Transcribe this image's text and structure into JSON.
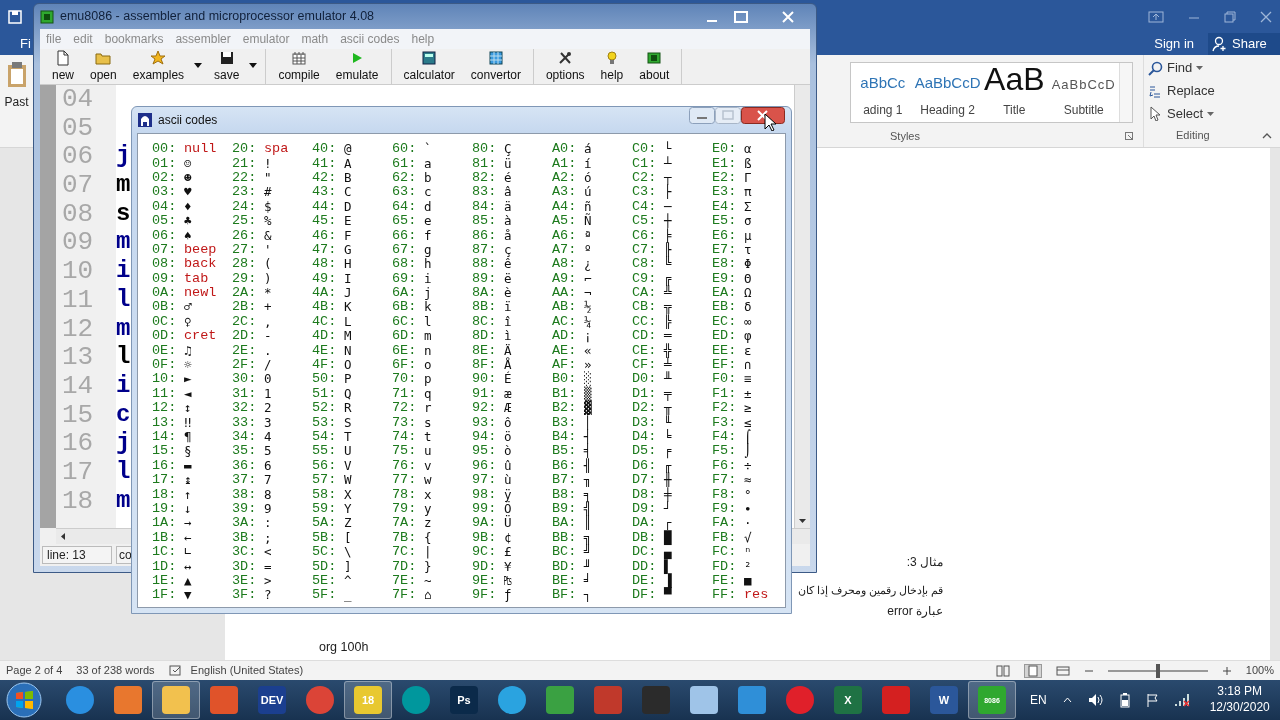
{
  "word": {
    "file_tab": "Fi",
    "paste_label": "Past",
    "sign_in": "Sign in",
    "share": "Share",
    "styles": [
      {
        "sample": "aBbCc",
        "label": "ading 1",
        "kind": "heading"
      },
      {
        "sample": "AaBbCcD",
        "label": "Heading 2",
        "kind": "heading"
      },
      {
        "sample": "AaB",
        "label": "Title",
        "kind": "title"
      },
      {
        "sample": "AaBbCcD",
        "label": "Subtitle",
        "kind": "subtitle"
      }
    ],
    "styles_group": "Styles",
    "editing": [
      {
        "label": "Find",
        "kind": "find",
        "dropdown": true
      },
      {
        "label": "Replace",
        "kind": "replace",
        "dropdown": false
      },
      {
        "label": "Select",
        "kind": "select",
        "dropdown": true
      }
    ],
    "editing_group": "Editing",
    "document": {
      "rtl_lines": [
        "مثال 3:",
        "قم بإدخال رقمين ومحرف إذا كان",
        "عبارة error"
      ],
      "code_line": "org 100h"
    },
    "status_bar": {
      "page": "Page 2 of 4",
      "words": "33 of 238 words",
      "language": "English (United States)",
      "zoom_slider": {
        "level": 0.5
      },
      "zoom": "100%"
    }
  },
  "emu": {
    "title": "emu8086 - assembler and microprocessor emulator 4.08",
    "menu": [
      "file",
      "edit",
      "bookmarks",
      "assembler",
      "emulator",
      "math",
      "ascii codes",
      "help"
    ],
    "toolbar": [
      {
        "items": [
          {
            "label": "new",
            "kind": "page",
            "dropdown": false
          },
          {
            "label": "open",
            "kind": "folder",
            "dropdown": false
          },
          {
            "label": "examples",
            "kind": "star",
            "dropdown": true
          },
          {
            "label": "save",
            "kind": "disk",
            "dropdown": true
          }
        ]
      },
      {
        "items": [
          {
            "label": "compile",
            "kind": "grid",
            "dropdown": false
          },
          {
            "label": "emulate",
            "kind": "play",
            "dropdown": false
          }
        ]
      },
      {
        "items": [
          {
            "label": "calculator",
            "kind": "calculator",
            "dropdown": false
          },
          {
            "label": "convertor",
            "kind": "convertor",
            "dropdown": false
          }
        ]
      },
      {
        "items": [
          {
            "label": "options",
            "kind": "tools",
            "dropdown": false
          },
          {
            "label": "help",
            "kind": "bulb",
            "dropdown": false
          },
          {
            "label": "about",
            "kind": "chip",
            "dropdown": false
          }
        ]
      }
    ],
    "editor": {
      "lines": [
        {
          "number": "04"
        },
        {
          "number": "05"
        },
        {
          "number": "06",
          "code": "j",
          "color": "#00008b"
        },
        {
          "number": "07",
          "code": "m",
          "color": "#000000"
        },
        {
          "number": "08",
          "code": "s",
          "color": "#000000"
        },
        {
          "number": "09",
          "code": "m",
          "color": "#00008b"
        },
        {
          "number": "10",
          "code": "i",
          "color": "#00008b"
        },
        {
          "number": "11",
          "code": "l",
          "color": "#00008b"
        },
        {
          "number": "12",
          "code": "m",
          "color": "#00008b"
        },
        {
          "number": "13",
          "code": "l",
          "color": "#000000"
        },
        {
          "number": "14",
          "code": "i",
          "color": "#00008b"
        },
        {
          "number": "15",
          "code": "c",
          "color": "#00008b"
        },
        {
          "number": "16",
          "code": "j",
          "color": "#00008b"
        },
        {
          "number": "17",
          "code": "l",
          "color": "#00008b"
        },
        {
          "number": "18",
          "code": "m",
          "color": "#00008b"
        }
      ]
    },
    "status": [
      "line: 13",
      "co"
    ]
  },
  "ascii": {
    "title": "ascii codes",
    "columns": [
      {
        "cells": [
          {
            "code": "00:",
            "symbol": "null",
            "kind": "name"
          },
          {
            "code": "01:",
            "symbol": "☺",
            "kind": "char"
          },
          {
            "code": "02:",
            "symbol": "☻",
            "kind": "char"
          },
          {
            "code": "03:",
            "symbol": "♥",
            "kind": "char"
          },
          {
            "code": "04:",
            "symbol": "♦",
            "kind": "char"
          },
          {
            "code": "05:",
            "symbol": "♣",
            "kind": "char"
          },
          {
            "code": "06:",
            "symbol": "♠",
            "kind": "char"
          },
          {
            "code": "07:",
            "symbol": "beep",
            "kind": "name"
          },
          {
            "code": "08:",
            "symbol": "back",
            "kind": "name"
          },
          {
            "code": "09:",
            "symbol": "tab",
            "kind": "name"
          },
          {
            "code": "0A:",
            "symbol": "newl",
            "kind": "name"
          },
          {
            "code": "0B:",
            "symbol": "♂",
            "kind": "char"
          },
          {
            "code": "0C:",
            "symbol": "♀",
            "kind": "char"
          },
          {
            "code": "0D:",
            "symbol": "cret",
            "kind": "name"
          },
          {
            "code": "0E:",
            "symbol": "♫",
            "kind": "char"
          },
          {
            "code": "0F:",
            "symbol": "☼",
            "kind": "char"
          },
          {
            "code": "10:",
            "symbol": "►",
            "kind": "char"
          },
          {
            "code": "11:",
            "symbol": "◄",
            "kind": "char"
          },
          {
            "code": "12:",
            "symbol": "↕",
            "kind": "char"
          },
          {
            "code": "13:",
            "symbol": "‼",
            "kind": "char"
          },
          {
            "code": "14:",
            "symbol": "¶",
            "kind": "char"
          },
          {
            "code": "15:",
            "symbol": "§",
            "kind": "char"
          },
          {
            "code": "16:",
            "symbol": "▬",
            "kind": "char"
          },
          {
            "code": "17:",
            "symbol": "↨",
            "kind": "char"
          },
          {
            "code": "18:",
            "symbol": "↑",
            "kind": "char"
          },
          {
            "code": "19:",
            "symbol": "↓",
            "kind": "char"
          },
          {
            "code": "1A:",
            "symbol": "→",
            "kind": "char"
          },
          {
            "code": "1B:",
            "symbol": "←",
            "kind": "char"
          },
          {
            "code": "1C:",
            "symbol": "∟",
            "kind": "char"
          },
          {
            "code": "1D:",
            "symbol": "↔",
            "kind": "char"
          },
          {
            "code": "1E:",
            "symbol": "▲",
            "kind": "char"
          },
          {
            "code": "1F:",
            "symbol": "▼",
            "kind": "char"
          }
        ]
      },
      {
        "cells": [
          {
            "code": "20:",
            "symbol": "spa",
            "kind": "name"
          },
          {
            "code": "21:",
            "symbol": "!",
            "kind": "char"
          },
          {
            "code": "22:",
            "symbol": "\"",
            "kind": "char"
          },
          {
            "code": "23:",
            "symbol": "#",
            "kind": "char"
          },
          {
            "code": "24:",
            "symbol": "$",
            "kind": "char"
          },
          {
            "code": "25:",
            "symbol": "%",
            "kind": "char"
          },
          {
            "code": "26:",
            "symbol": "&",
            "kind": "char"
          },
          {
            "code": "27:",
            "symbol": "'",
            "kind": "char"
          },
          {
            "code": "28:",
            "symbol": "(",
            "kind": "char"
          },
          {
            "code": "29:",
            "symbol": ")",
            "kind": "char"
          },
          {
            "code": "2A:",
            "symbol": "*",
            "kind": "char"
          },
          {
            "code": "2B:",
            "symbol": "+",
            "kind": "char"
          },
          {
            "code": "2C:",
            "symbol": ",",
            "kind": "char"
          },
          {
            "code": "2D:",
            "symbol": "-",
            "kind": "char"
          },
          {
            "code": "2E:",
            "symbol": ".",
            "kind": "char"
          },
          {
            "code": "2F:",
            "symbol": "/",
            "kind": "char"
          },
          {
            "code": "30:",
            "symbol": "0",
            "kind": "char"
          },
          {
            "code": "31:",
            "symbol": "1",
            "kind": "char"
          },
          {
            "code": "32:",
            "symbol": "2",
            "kind": "char"
          },
          {
            "code": "33:",
            "symbol": "3",
            "kind": "char"
          },
          {
            "code": "34:",
            "symbol": "4",
            "kind": "char"
          },
          {
            "code": "35:",
            "symbol": "5",
            "kind": "char"
          },
          {
            "code": "36:",
            "symbol": "6",
            "kind": "char"
          },
          {
            "code": "37:",
            "symbol": "7",
            "kind": "char"
          },
          {
            "code": "38:",
            "symbol": "8",
            "kind": "char"
          },
          {
            "code": "39:",
            "symbol": "9",
            "kind": "char"
          },
          {
            "code": "3A:",
            "symbol": ":",
            "kind": "char"
          },
          {
            "code": "3B:",
            "symbol": ";",
            "kind": "char"
          },
          {
            "code": "3C:",
            "symbol": "<",
            "kind": "char"
          },
          {
            "code": "3D:",
            "symbol": "=",
            "kind": "char"
          },
          {
            "code": "3E:",
            "symbol": ">",
            "kind": "char"
          },
          {
            "code": "3F:",
            "symbol": "?",
            "kind": "char"
          }
        ]
      },
      {
        "cells": [
          {
            "code": "40:",
            "symbol": "@",
            "kind": "char"
          },
          {
            "code": "41:",
            "symbol": "A",
            "kind": "char"
          },
          {
            "code": "42:",
            "symbol": "B",
            "kind": "char"
          },
          {
            "code": "43:",
            "symbol": "C",
            "kind": "char"
          },
          {
            "code": "44:",
            "symbol": "D",
            "kind": "char"
          },
          {
            "code": "45:",
            "symbol": "E",
            "kind": "char"
          },
          {
            "code": "46:",
            "symbol": "F",
            "kind": "char"
          },
          {
            "code": "47:",
            "symbol": "G",
            "kind": "char"
          },
          {
            "code": "48:",
            "symbol": "H",
            "kind": "char"
          },
          {
            "code": "49:",
            "symbol": "I",
            "kind": "char"
          },
          {
            "code": "4A:",
            "symbol": "J",
            "kind": "char"
          },
          {
            "code": "4B:",
            "symbol": "K",
            "kind": "char"
          },
          {
            "code": "4C:",
            "symbol": "L",
            "kind": "char"
          },
          {
            "code": "4D:",
            "symbol": "M",
            "kind": "char"
          },
          {
            "code": "4E:",
            "symbol": "N",
            "kind": "char"
          },
          {
            "code": "4F:",
            "symbol": "O",
            "kind": "char"
          },
          {
            "code": "50:",
            "symbol": "P",
            "kind": "char"
          },
          {
            "code": "51:",
            "symbol": "Q",
            "kind": "char"
          },
          {
            "code": "52:",
            "symbol": "R",
            "kind": "char"
          },
          {
            "code": "53:",
            "symbol": "S",
            "kind": "char"
          },
          {
            "code": "54:",
            "symbol": "T",
            "kind": "char"
          },
          {
            "code": "55:",
            "symbol": "U",
            "kind": "char"
          },
          {
            "code": "56:",
            "symbol": "V",
            "kind": "char"
          },
          {
            "code": "57:",
            "symbol": "W",
            "kind": "char"
          },
          {
            "code": "58:",
            "symbol": "X",
            "kind": "char"
          },
          {
            "code": "59:",
            "symbol": "Y",
            "kind": "char"
          },
          {
            "code": "5A:",
            "symbol": "Z",
            "kind": "char"
          },
          {
            "code": "5B:",
            "symbol": "[",
            "kind": "char"
          },
          {
            "code": "5C:",
            "symbol": "\\",
            "kind": "char"
          },
          {
            "code": "5D:",
            "symbol": "]",
            "kind": "char"
          },
          {
            "code": "5E:",
            "symbol": "^",
            "kind": "char"
          },
          {
            "code": "5F:",
            "symbol": "_",
            "kind": "char"
          }
        ]
      },
      {
        "cells": [
          {
            "code": "60:",
            "symbol": "`",
            "kind": "char"
          },
          {
            "code": "61:",
            "symbol": "a",
            "kind": "char"
          },
          {
            "code": "62:",
            "symbol": "b",
            "kind": "char"
          },
          {
            "code": "63:",
            "symbol": "c",
            "kind": "char"
          },
          {
            "code": "64:",
            "symbol": "d",
            "kind": "char"
          },
          {
            "code": "65:",
            "symbol": "e",
            "kind": "char"
          },
          {
            "code": "66:",
            "symbol": "f",
            "kind": "char"
          },
          {
            "code": "67:",
            "symbol": "g",
            "kind": "char"
          },
          {
            "code": "68:",
            "symbol": "h",
            "kind": "char"
          },
          {
            "code": "69:",
            "symbol": "i",
            "kind": "char"
          },
          {
            "code": "6A:",
            "symbol": "j",
            "kind": "char"
          },
          {
            "code": "6B:",
            "symbol": "k",
            "kind": "char"
          },
          {
            "code": "6C:",
            "symbol": "l",
            "kind": "char"
          },
          {
            "code": "6D:",
            "symbol": "m",
            "kind": "char"
          },
          {
            "code": "6E:",
            "symbol": "n",
            "kind": "char"
          },
          {
            "code": "6F:",
            "symbol": "o",
            "kind": "char"
          },
          {
            "code": "70:",
            "symbol": "p",
            "kind": "char"
          },
          {
            "code": "71:",
            "symbol": "q",
            "kind": "char"
          },
          {
            "code": "72:",
            "symbol": "r",
            "kind": "char"
          },
          {
            "code": "73:",
            "symbol": "s",
            "kind": "char"
          },
          {
            "code": "74:",
            "symbol": "t",
            "kind": "char"
          },
          {
            "code": "75:",
            "symbol": "u",
            "kind": "char"
          },
          {
            "code": "76:",
            "symbol": "v",
            "kind": "char"
          },
          {
            "code": "77:",
            "symbol": "w",
            "kind": "char"
          },
          {
            "code": "78:",
            "symbol": "x",
            "kind": "char"
          },
          {
            "code": "79:",
            "symbol": "y",
            "kind": "char"
          },
          {
            "code": "7A:",
            "symbol": "z",
            "kind": "char"
          },
          {
            "code": "7B:",
            "symbol": "{",
            "kind": "char"
          },
          {
            "code": "7C:",
            "symbol": "|",
            "kind": "char"
          },
          {
            "code": "7D:",
            "symbol": "}",
            "kind": "char"
          },
          {
            "code": "7E:",
            "symbol": "~",
            "kind": "char"
          },
          {
            "code": "7F:",
            "symbol": "⌂",
            "kind": "char"
          }
        ]
      },
      {
        "cells": [
          {
            "code": "80:",
            "symbol": "Ç",
            "kind": "char"
          },
          {
            "code": "81:",
            "symbol": "ü",
            "kind": "char"
          },
          {
            "code": "82:",
            "symbol": "é",
            "kind": "char"
          },
          {
            "code": "83:",
            "symbol": "â",
            "kind": "char"
          },
          {
            "code": "84:",
            "symbol": "ä",
            "kind": "char"
          },
          {
            "code": "85:",
            "symbol": "à",
            "kind": "char"
          },
          {
            "code": "86:",
            "symbol": "å",
            "kind": "char"
          },
          {
            "code": "87:",
            "symbol": "ç",
            "kind": "char"
          },
          {
            "code": "88:",
            "symbol": "ê",
            "kind": "char"
          },
          {
            "code": "89:",
            "symbol": "ë",
            "kind": "char"
          },
          {
            "code": "8A:",
            "symbol": "è",
            "kind": "char"
          },
          {
            "code": "8B:",
            "symbol": "ï",
            "kind": "char"
          },
          {
            "code": "8C:",
            "symbol": "î",
            "kind": "char"
          },
          {
            "code": "8D:",
            "symbol": "ì",
            "kind": "char"
          },
          {
            "code": "8E:",
            "symbol": "Ä",
            "kind": "char"
          },
          {
            "code": "8F:",
            "symbol": "Å",
            "kind": "char"
          },
          {
            "code": "90:",
            "symbol": "É",
            "kind": "char"
          },
          {
            "code": "91:",
            "symbol": "æ",
            "kind": "char"
          },
          {
            "code": "92:",
            "symbol": "Æ",
            "kind": "char"
          },
          {
            "code": "93:",
            "symbol": "ô",
            "kind": "char"
          },
          {
            "code": "94:",
            "symbol": "ö",
            "kind": "char"
          },
          {
            "code": "95:",
            "symbol": "ò",
            "kind": "char"
          },
          {
            "code": "96:",
            "symbol": "û",
            "kind": "char"
          },
          {
            "code": "97:",
            "symbol": "ù",
            "kind": "char"
          },
          {
            "code": "98:",
            "symbol": "ÿ",
            "kind": "char"
          },
          {
            "code": "99:",
            "symbol": "Ö",
            "kind": "char"
          },
          {
            "code": "9A:",
            "symbol": "Ü",
            "kind": "char"
          },
          {
            "code": "9B:",
            "symbol": "¢",
            "kind": "char"
          },
          {
            "code": "9C:",
            "symbol": "£",
            "kind": "char"
          },
          {
            "code": "9D:",
            "symbol": "¥",
            "kind": "char"
          },
          {
            "code": "9E:",
            "symbol": "₧",
            "kind": "char"
          },
          {
            "code": "9F:",
            "symbol": "ƒ",
            "kind": "char"
          }
        ]
      },
      {
        "cells": [
          {
            "code": "A0:",
            "symbol": "á",
            "kind": "char"
          },
          {
            "code": "A1:",
            "symbol": "í",
            "kind": "char"
          },
          {
            "code": "A2:",
            "symbol": "ó",
            "kind": "char"
          },
          {
            "code": "A3:",
            "symbol": "ú",
            "kind": "char"
          },
          {
            "code": "A4:",
            "symbol": "ñ",
            "kind": "char"
          },
          {
            "code": "A5:",
            "symbol": "Ñ",
            "kind": "char"
          },
          {
            "code": "A6:",
            "symbol": "ª",
            "kind": "char"
          },
          {
            "code": "A7:",
            "symbol": "º",
            "kind": "char"
          },
          {
            "code": "A8:",
            "symbol": "¿",
            "kind": "char"
          },
          {
            "code": "A9:",
            "symbol": "⌐",
            "kind": "char"
          },
          {
            "code": "AA:",
            "symbol": "¬",
            "kind": "char"
          },
          {
            "code": "AB:",
            "symbol": "½",
            "kind": "char"
          },
          {
            "code": "AC:",
            "symbol": "¼",
            "kind": "char"
          },
          {
            "code": "AD:",
            "symbol": "¡",
            "kind": "char"
          },
          {
            "code": "AE:",
            "symbol": "«",
            "kind": "char"
          },
          {
            "code": "AF:",
            "symbol": "»",
            "kind": "char"
          },
          {
            "code": "B0:",
            "symbol": "░",
            "kind": "char"
          },
          {
            "code": "B1:",
            "symbol": "▒",
            "kind": "char"
          },
          {
            "code": "B2:",
            "symbol": "▓",
            "kind": "char"
          },
          {
            "code": "B3:",
            "symbol": "│",
            "kind": "char"
          },
          {
            "code": "B4:",
            "symbol": "┤",
            "kind": "char"
          },
          {
            "code": "B5:",
            "symbol": "╡",
            "kind": "char"
          },
          {
            "code": "B6:",
            "symbol": "╢",
            "kind": "char"
          },
          {
            "code": "B7:",
            "symbol": "╖",
            "kind": "char"
          },
          {
            "code": "B8:",
            "symbol": "╕",
            "kind": "char"
          },
          {
            "code": "B9:",
            "symbol": "╣",
            "kind": "char"
          },
          {
            "code": "BA:",
            "symbol": "║",
            "kind": "char"
          },
          {
            "code": "BB:",
            "symbol": "╗",
            "kind": "char"
          },
          {
            "code": "BC:",
            "symbol": "╝",
            "kind": "char"
          },
          {
            "code": "BD:",
            "symbol": "╜",
            "kind": "char"
          },
          {
            "code": "BE:",
            "symbol": "╛",
            "kind": "char"
          },
          {
            "code": "BF:",
            "symbol": "┐",
            "kind": "char"
          }
        ]
      },
      {
        "cells": [
          {
            "code": "C0:",
            "symbol": "└",
            "kind": "char"
          },
          {
            "code": "C1:",
            "symbol": "┴",
            "kind": "char"
          },
          {
            "code": "C2:",
            "symbol": "┬",
            "kind": "char"
          },
          {
            "code": "C3:",
            "symbol": "├",
            "kind": "char"
          },
          {
            "code": "C4:",
            "symbol": "─",
            "kind": "char"
          },
          {
            "code": "C5:",
            "symbol": "┼",
            "kind": "char"
          },
          {
            "code": "C6:",
            "symbol": "╞",
            "kind": "char"
          },
          {
            "code": "C7:",
            "symbol": "╟",
            "kind": "char"
          },
          {
            "code": "C8:",
            "symbol": "╚",
            "kind": "char"
          },
          {
            "code": "C9:",
            "symbol": "╔",
            "kind": "char"
          },
          {
            "code": "CA:",
            "symbol": "╩",
            "kind": "char"
          },
          {
            "code": "CB:",
            "symbol": "╦",
            "kind": "char"
          },
          {
            "code": "CC:",
            "symbol": "╠",
            "kind": "char"
          },
          {
            "code": "CD:",
            "symbol": "═",
            "kind": "char"
          },
          {
            "code": "CE:",
            "symbol": "╬",
            "kind": "char"
          },
          {
            "code": "CF:",
            "symbol": "╧",
            "kind": "char"
          },
          {
            "code": "D0:",
            "symbol": "╨",
            "kind": "char"
          },
          {
            "code": "D1:",
            "symbol": "╤",
            "kind": "char"
          },
          {
            "code": "D2:",
            "symbol": "╥",
            "kind": "char"
          },
          {
            "code": "D3:",
            "symbol": "╙",
            "kind": "char"
          },
          {
            "code": "D4:",
            "symbol": "╘",
            "kind": "char"
          },
          {
            "code": "D5:",
            "symbol": "╒",
            "kind": "char"
          },
          {
            "code": "D6:",
            "symbol": "╓",
            "kind": "char"
          },
          {
            "code": "D7:",
            "symbol": "╫",
            "kind": "char"
          },
          {
            "code": "D8:",
            "symbol": "╪",
            "kind": "char"
          },
          {
            "code": "D9:",
            "symbol": "┘",
            "kind": "char"
          },
          {
            "code": "DA:",
            "symbol": "┌",
            "kind": "char"
          },
          {
            "code": "DB:",
            "symbol": "█",
            "kind": "char"
          },
          {
            "code": "DC:",
            "symbol": "▄",
            "kind": "char"
          },
          {
            "code": "DD:",
            "symbol": "▌",
            "kind": "char"
          },
          {
            "code": "DE:",
            "symbol": "▐",
            "kind": "char"
          },
          {
            "code": "DF:",
            "symbol": "▀",
            "kind": "char"
          }
        ]
      },
      {
        "cells": [
          {
            "code": "E0:",
            "symbol": "α",
            "kind": "char"
          },
          {
            "code": "E1:",
            "symbol": "ß",
            "kind": "char"
          },
          {
            "code": "E2:",
            "symbol": "Γ",
            "kind": "char"
          },
          {
            "code": "E3:",
            "symbol": "π",
            "kind": "char"
          },
          {
            "code": "E4:",
            "symbol": "Σ",
            "kind": "char"
          },
          {
            "code": "E5:",
            "symbol": "σ",
            "kind": "char"
          },
          {
            "code": "E6:",
            "symbol": "µ",
            "kind": "char"
          },
          {
            "code": "E7:",
            "symbol": "τ",
            "kind": "char"
          },
          {
            "code": "E8:",
            "symbol": "Φ",
            "kind": "char"
          },
          {
            "code": "E9:",
            "symbol": "Θ",
            "kind": "char"
          },
          {
            "code": "EA:",
            "symbol": "Ω",
            "kind": "char"
          },
          {
            "code": "EB:",
            "symbol": "δ",
            "kind": "char"
          },
          {
            "code": "EC:",
            "symbol": "∞",
            "kind": "char"
          },
          {
            "code": "ED:",
            "symbol": "φ",
            "kind": "char"
          },
          {
            "code": "EE:",
            "symbol": "ε",
            "kind": "char"
          },
          {
            "code": "EF:",
            "symbol": "∩",
            "kind": "char"
          },
          {
            "code": "F0:",
            "symbol": "≡",
            "kind": "char"
          },
          {
            "code": "F1:",
            "symbol": "±",
            "kind": "char"
          },
          {
            "code": "F2:",
            "symbol": "≥",
            "kind": "char"
          },
          {
            "code": "F3:",
            "symbol": "≤",
            "kind": "char"
          },
          {
            "code": "F4:",
            "symbol": "⌠",
            "kind": "char"
          },
          {
            "code": "F5:",
            "symbol": "⌡",
            "kind": "char"
          },
          {
            "code": "F6:",
            "symbol": "÷",
            "kind": "char"
          },
          {
            "code": "F7:",
            "symbol": "≈",
            "kind": "char"
          },
          {
            "code": "F8:",
            "symbol": "°",
            "kind": "char"
          },
          {
            "code": "F9:",
            "symbol": "∙",
            "kind": "char"
          },
          {
            "code": "FA:",
            "symbol": "·",
            "kind": "char"
          },
          {
            "code": "FB:",
            "symbol": "√",
            "kind": "char"
          },
          {
            "code": "FC:",
            "symbol": "ⁿ",
            "kind": "char"
          },
          {
            "code": "FD:",
            "symbol": "²",
            "kind": "char"
          },
          {
            "code": "FE:",
            "symbol": "■",
            "kind": "char"
          },
          {
            "code": "FF:",
            "symbol": "res",
            "kind": "name"
          }
        ]
      }
    ]
  },
  "taskbar": {
    "apps": [
      {
        "kind": "round",
        "color": "#2a8fe0",
        "selected": false
      },
      {
        "kind": "tile",
        "color": "#e8772e",
        "selected": false
      },
      {
        "kind": "tile",
        "color": "#f2c14e",
        "selected": true
      },
      {
        "kind": "tile",
        "color": "#e0532a",
        "selected": false
      },
      {
        "kind": "tile",
        "color": "#1b3f8f",
        "label": "DEV",
        "selected": false
      },
      {
        "kind": "round",
        "color": "#db4437",
        "selected": false
      },
      {
        "kind": "tile",
        "color": "#e8c830",
        "label": "18",
        "selected": true
      },
      {
        "kind": "round",
        "color": "#00979d",
        "selected": false
      },
      {
        "kind": "tile",
        "color": "#0b2a4a",
        "label": "Ps",
        "selected": false
      },
      {
        "kind": "round",
        "color": "#2aa3e0",
        "selected": false
      },
      {
        "kind": "tile",
        "color": "#3aa142",
        "selected": false
      },
      {
        "kind": "tile",
        "color": "#c0392b",
        "selected": false
      },
      {
        "kind": "tile",
        "color": "#2b2b2b",
        "selected": false
      },
      {
        "kind": "tile",
        "color": "#9fc4e8",
        "selected": false
      },
      {
        "kind": "tile",
        "color": "#2f8fd8",
        "selected": false
      },
      {
        "kind": "round",
        "color": "#e0202a",
        "selected": false
      },
      {
        "kind": "tile",
        "color": "#1f7244",
        "label": "X",
        "selected": false
      },
      {
        "kind": "tile",
        "color": "#d42020",
        "selected": false
      },
      {
        "kind": "tile",
        "color": "#2b579a",
        "label": "W",
        "selected": false
      },
      {
        "kind": "tile",
        "color": "#2fa82f",
        "label": "8086",
        "selected": true
      }
    ],
    "language": "EN",
    "time": "3:18 PM",
    "date": "12/30/2020"
  }
}
